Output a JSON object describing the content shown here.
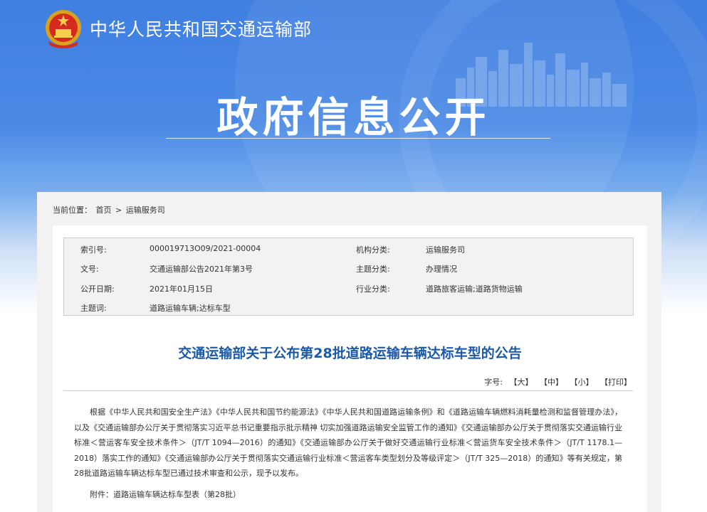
{
  "header": {
    "ministry_name": "中华人民共和国交通运输部",
    "section_title": "政府信息公开"
  },
  "breadcrumb": {
    "prefix": "当前位置：",
    "home": "首页",
    "separator": ">",
    "current": "运输服务司"
  },
  "meta": {
    "index_label": "索引号:",
    "index_value": "000019713O09/2021-00004",
    "org_label": "机构分类:",
    "org_value": "运输服务司",
    "doc_no_label": "文号:",
    "doc_no_value": "交通运输部公告2021年第3号",
    "topic_label": "主题分类:",
    "topic_value": "办理情况",
    "date_label": "公开日期:",
    "date_value": "2021年01月15日",
    "industry_label": "行业分类:",
    "industry_value": "道路旅客运输;道路货物运输",
    "keywords_label": "主题词:",
    "keywords_value": "道路运输车辆;达标车型"
  },
  "article": {
    "title": "交通运输部关于公布第28批道路运输车辆达标车型的公告",
    "font_size_label": "字号:",
    "font_large": "【大】",
    "font_medium": "【中】",
    "font_small": "【小】",
    "print": "【打印】",
    "body": "根据《中华人民共和国安全生产法》《中华人民共和国节约能源法》《中华人民共和国道路运输条例》和《道路运输车辆燃料消耗量检测和监督管理办法》，以及《交通运输部办公厅关于贯彻落实习近平总书记重要指示批示精神 切实加强道路运输安全监管工作的通知》《交通运输部办公厅关于贯彻落实交通运输行业标准＜营运客车安全技术条件＞（JT/T 1094—2016）的通知》《交通运输部办公厅关于做好交通运输行业标准＜营运货车安全技术条件＞（JT/T 1178.1—2018）落实工作的通知》《交通运输部办公厅关于贯彻落实交通运输行业标准＜营运客车类型划分及等级评定＞（JT/T 325—2018）的通知》等有关规定，第28批道路运输车辆达标车型已通过技术审查和公示，现予以发布。",
    "attachment": "附件：道路运输车辆达标车型表（第28批）"
  }
}
